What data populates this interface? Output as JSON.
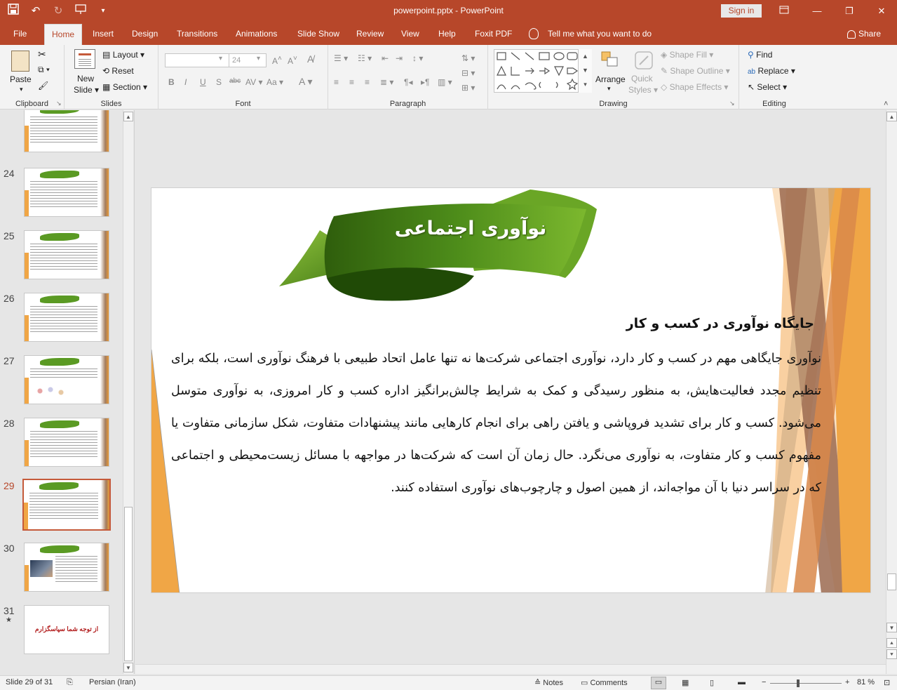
{
  "app": {
    "doc_title": "powerpoint.pptx  -  PowerPoint",
    "signin_label": "Sign in"
  },
  "tabs": [
    "File",
    "Home",
    "Insert",
    "Design",
    "Transitions",
    "Animations",
    "Slide Show",
    "Review",
    "View",
    "Help",
    "Foxit PDF"
  ],
  "active_tab": "Home",
  "tell_me": "Tell me what you want to do",
  "share_label": "Share",
  "ribbon": {
    "clipboard": {
      "label": "Clipboard",
      "paste": "Paste"
    },
    "slides": {
      "label": "Slides",
      "new_slide_1": "New",
      "new_slide_2": "Slide",
      "layout": "Layout",
      "reset": "Reset",
      "section": "Section"
    },
    "font": {
      "label": "Font",
      "font_name": "",
      "font_size": "24",
      "bold": "B",
      "italic": "I",
      "underline": "U",
      "shadow": "S",
      "strike": "abc"
    },
    "paragraph": {
      "label": "Paragraph"
    },
    "drawing": {
      "label": "Drawing",
      "arrange": "Arrange",
      "quick_styles_1": "Quick",
      "quick_styles_2": "Styles",
      "shape_fill": "Shape Fill",
      "shape_outline": "Shape Outline",
      "shape_effects": "Shape Effects"
    },
    "editing": {
      "label": "Editing",
      "find": "Find",
      "replace": "Replace",
      "select": "Select"
    }
  },
  "thumbnails": [
    {
      "num": "24",
      "kind": "text"
    },
    {
      "num": "25",
      "kind": "text"
    },
    {
      "num": "26",
      "kind": "text"
    },
    {
      "num": "27",
      "kind": "diagram"
    },
    {
      "num": "28",
      "kind": "text"
    },
    {
      "num": "29",
      "kind": "text",
      "selected": true
    },
    {
      "num": "30",
      "kind": "photo"
    },
    {
      "num": "31",
      "kind": "end",
      "star": "★",
      "endtext": "از توجه شما سپاسگزارم"
    }
  ],
  "slide": {
    "title": "نوآوری اجتماعی",
    "subtitle": "جایگاه نوآوری در کسب و کار",
    "paragraph": "نوآوری جایگاهی مهم در کسب و کار دارد، نوآوری اجتماعی شرکت‌ها نه تنها عامل اتحاد طبیعی با فرهنگ نوآوری است، بلکه برای تنظیم مجدد فعالیت‌هایش، به منظور رسیدگی و کمک به شرایط چالش‌برانگیز اداره کسب و کار امروزی، به نوآوری متوسل می‌شود. کسب و کار برای تشدید فروپاشی و یافتن راهی برای انجام کارهایی مانند پیشنهادات متفاوت، شکل سازمانی متفاوت یا مفهوم کسب و کار متفاوت، به نوآوری می‌نگرد. حال زمان آن است که شرکت‌ها در مواجهه با مسائل زیست‌محیطی و اجتماعی که در سراسر دنیا با آن مواجه‌اند، از همین اصول و چارچوب‌های نوآوری استفاده کنند."
  },
  "status": {
    "slide_info": "Slide 29 of 31",
    "language": "Persian (Iran)",
    "notes": "Notes",
    "comments": "Comments",
    "zoom_minus": "−",
    "zoom_plus": "+",
    "zoom": "81 %"
  },
  "colors": {
    "brand": "#b7472a",
    "banner_green": "#5c9e1f",
    "accent_orange": "#f0a646"
  }
}
